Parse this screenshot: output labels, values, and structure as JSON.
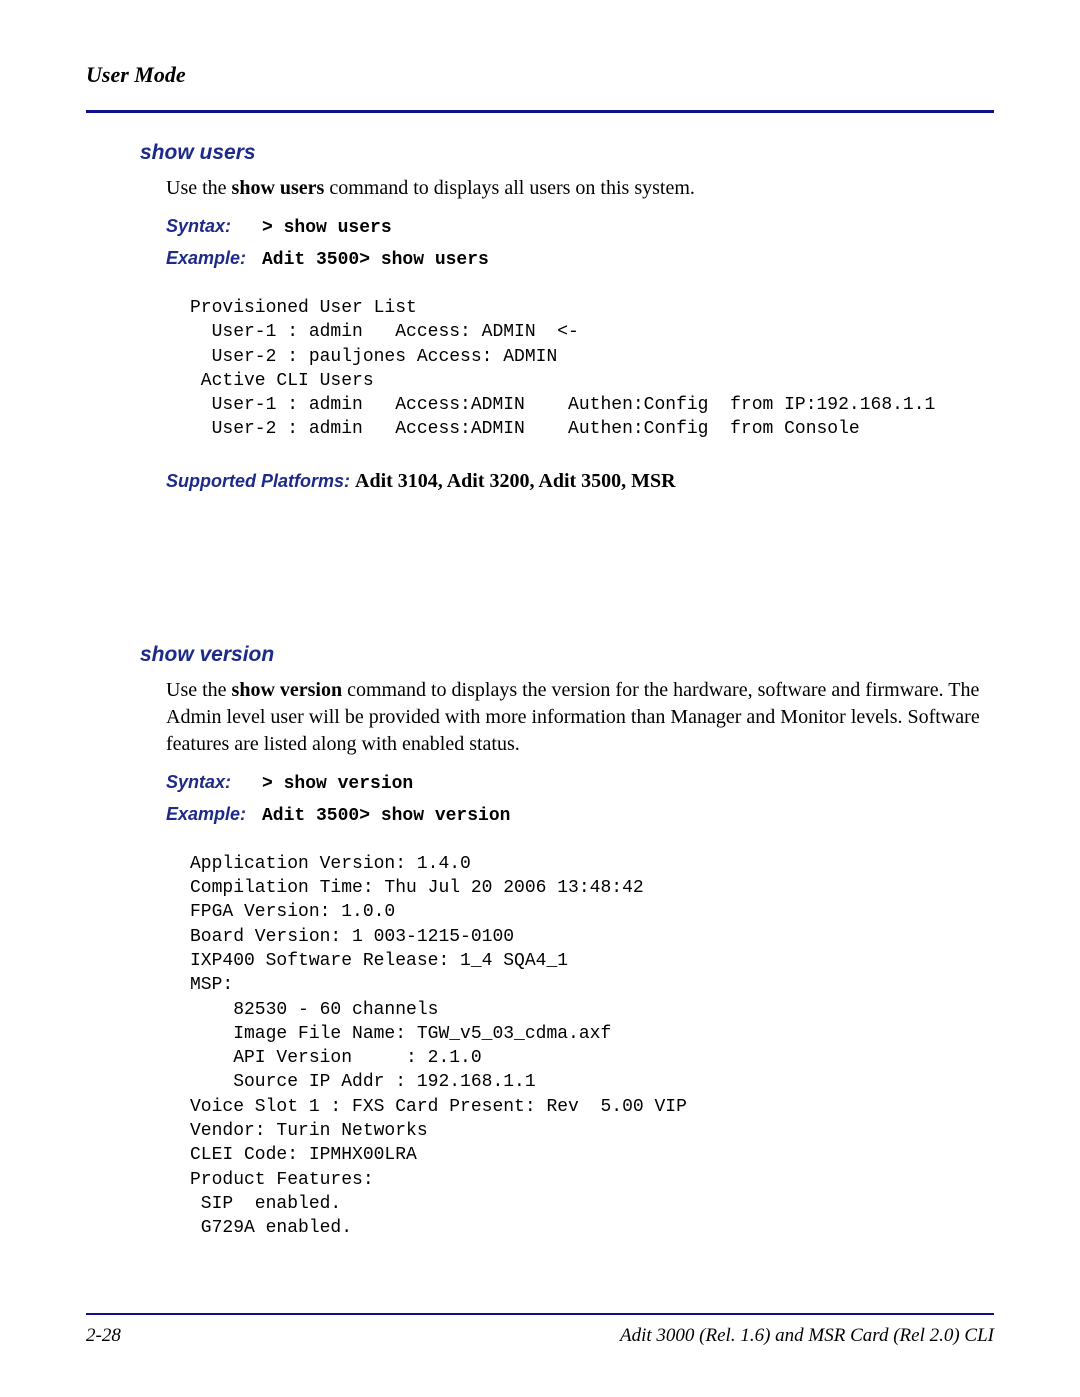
{
  "header": {
    "title": "User Mode"
  },
  "sections": {
    "show_users": {
      "heading": "show users",
      "intro_pre": "Use the ",
      "intro_cmd": "show users",
      "intro_post": " command to displays all users on this system.",
      "syntax_label": "Syntax:",
      "syntax_value": "> show users",
      "example_label": "Example:",
      "example_value": "Adit 3500> show users",
      "output": "Provisioned User List\n  User-1 : admin   Access: ADMIN  <-\n  User-2 : pauljones Access: ADMIN\n Active CLI Users\n  User-1 : admin   Access:ADMIN    Authen:Config  from IP:192.168.1.1\n  User-2 : admin   Access:ADMIN    Authen:Config  from Console",
      "supported_label": "Supported Platforms:  ",
      "supported_value": "Adit 3104, Adit 3200, Adit 3500, MSR"
    },
    "show_version": {
      "heading": "show version",
      "intro_pre": "Use the ",
      "intro_cmd": "show version",
      "intro_post": " command to displays the version for the hardware, software and firmware. The Admin level user will be provided with more information than Manager and Monitor levels. Software features are listed along with enabled status.",
      "syntax_label": "Syntax:",
      "syntax_value": "> show version",
      "example_label": "Example:",
      "example_value": "Adit 3500> show version",
      "output": "Application Version: 1.4.0\nCompilation Time: Thu Jul 20 2006 13:48:42\nFPGA Version: 1.0.0\nBoard Version: 1 003-1215-0100\nIXP400 Software Release: 1_4 SQA4_1\nMSP:\n    82530 - 60 channels\n    Image File Name: TGW_v5_03_cdma.axf\n    API Version     : 2.1.0\n    Source IP Addr : 192.168.1.1\nVoice Slot 1 : FXS Card Present: Rev  5.00 VIP\nVendor: Turin Networks\nCLEI Code: IPMHX00LRA\nProduct Features:\n SIP  enabled.\n G729A enabled."
    }
  },
  "footer": {
    "page": "2-28",
    "doc": "Adit 3000 (Rel. 1.6) and MSR Card (Rel 2.0) CLI"
  }
}
